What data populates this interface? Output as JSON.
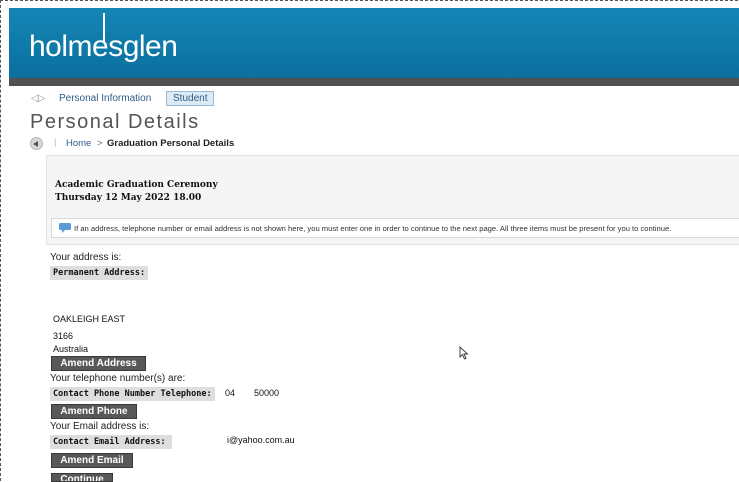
{
  "brand": {
    "logo_text": "holmesglen"
  },
  "tabs": {
    "personal_label": "Personal Information",
    "student_label": "Student"
  },
  "page": {
    "title": "Personal Details"
  },
  "breadcrumb": {
    "home": "Home",
    "separator": ">",
    "current": "Graduation Personal Details"
  },
  "ceremony": {
    "title": "Academic Graduation Ceremony",
    "date": "Thursday 12 May 2022 18.00",
    "notice": "If an address, telephone number or email address is not shown here, you must enter one in order to continue to the next page. All three items must be present for you to continue."
  },
  "address": {
    "intro": "Your address is:",
    "label": "Permanent Address:",
    "suburb": "OAKLEIGH EAST",
    "postcode": "3166",
    "country": "Australia",
    "amend_button": "Amend Address"
  },
  "phone": {
    "intro": "Your telephone number(s) are:",
    "label": "Contact Phone Number Telephone:",
    "value_prefix": "04",
    "value_suffix": "50000",
    "amend_button": "Amend Phone"
  },
  "email": {
    "intro": "Your Email address is:",
    "label": "Contact Email Address:",
    "value": "i@yahoo.com.au",
    "amend_button": "Amend Email"
  },
  "continue_button": "Continue",
  "icons": {
    "back": "back-arrow-icon",
    "info": "info-icon",
    "cursor": "mouse-cursor-icon"
  },
  "colors": {
    "header": "#0b7aad",
    "button": "#585858",
    "link": "#2e5d86"
  }
}
